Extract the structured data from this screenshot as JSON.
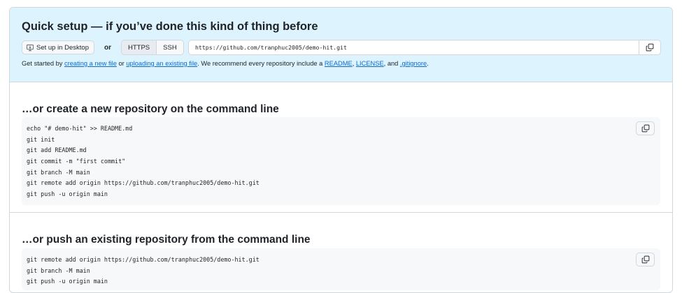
{
  "quick_setup": {
    "title": "Quick setup — if you’ve done this kind of thing before",
    "desktop_button": "Set up in Desktop",
    "or_label": "or",
    "protocols": [
      "HTTPS",
      "SSH"
    ],
    "selected_protocol": "HTTPS",
    "clone_url": "https://github.com/tranphuc2005/demo-hit.git",
    "intro": {
      "t1": "Get started by ",
      "link_new_file": "creating a new file",
      "t2": " or ",
      "link_upload": "uploading an existing file",
      "t3": ". We recommend every repository include a ",
      "link_readme": "README",
      "t4": ", ",
      "link_license": "LICENSE",
      "t5": ", and ",
      "link_gitignore": ".gitignore",
      "t6": "."
    }
  },
  "new_repo": {
    "title": "…or create a new repository on the command line",
    "lines": [
      "echo \"# demo-hit\" >> README.md",
      "git init",
      "git add README.md",
      "git commit -m \"first commit\"",
      "git branch -M main",
      "git remote add origin https://github.com/tranphuc2005/demo-hit.git",
      "git push -u origin main"
    ]
  },
  "push_existing": {
    "title": "…or push an existing repository from the command line",
    "lines": [
      "git remote add origin https://github.com/tranphuc2005/demo-hit.git",
      "git branch -M main",
      "git push -u origin main"
    ]
  },
  "colors": {
    "accent": "#0969da",
    "quick_bg": "#ddf4ff",
    "code_bg": "#f6f8fa",
    "border": "#d0d7de"
  }
}
